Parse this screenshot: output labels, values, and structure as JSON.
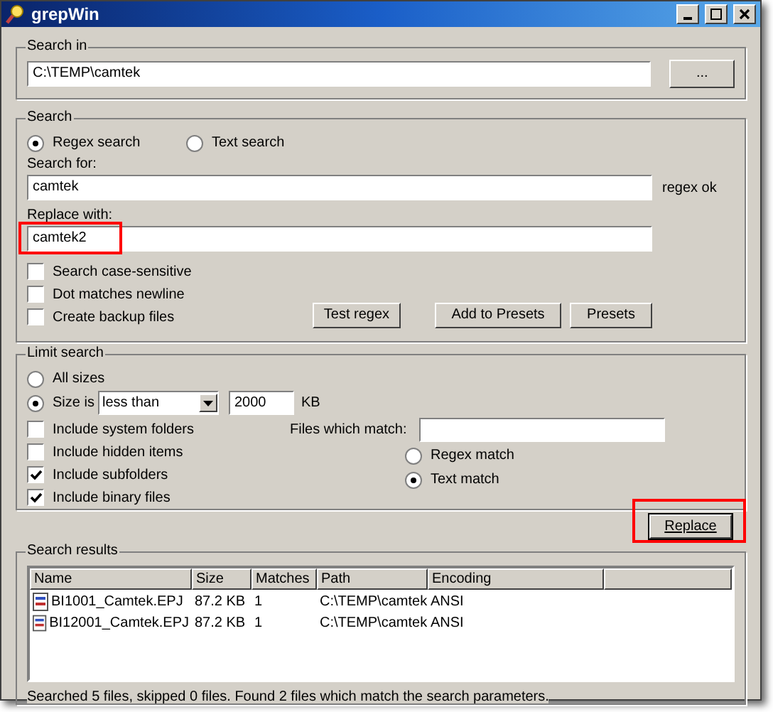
{
  "window": {
    "title": "grepWin"
  },
  "search_in": {
    "label": "Search in",
    "path": "C:\\TEMP\\camtek",
    "browse_button": "..."
  },
  "search": {
    "label": "Search",
    "modes": [
      {
        "label": "Regex search",
        "selected": true
      },
      {
        "label": "Text search",
        "selected": false
      }
    ],
    "search_for_label": "Search for:",
    "search_for": "camtek",
    "regex_status": "regex ok",
    "replace_label": "Replace with:",
    "replace_with": "camtek2",
    "replace_with_highlighted": true,
    "options": [
      {
        "label": "Search case-sensitive",
        "checked": false
      },
      {
        "label": "Dot matches newline",
        "checked": false
      },
      {
        "label": "Create backup files",
        "checked": false
      }
    ],
    "buttons": [
      "Test regex",
      "Add to Presets",
      "Presets"
    ]
  },
  "limit": {
    "label": "Limit search",
    "sizes": [
      {
        "label": "All sizes",
        "selected": false
      },
      {
        "label": "Size is",
        "selected": true
      }
    ],
    "size_condition": "less than",
    "size_value": "2000",
    "size_unit": "KB",
    "options": [
      {
        "label": "Include system folders",
        "checked": false
      },
      {
        "label": "Include hidden items",
        "checked": false
      },
      {
        "label": "Include subfolders",
        "checked": true
      },
      {
        "label": "Include binary files",
        "checked": true
      }
    ],
    "files_match_label": "Files which match:",
    "match_modes": [
      {
        "label": "Regex match",
        "selected": false
      },
      {
        "label": "Text match",
        "selected": true
      }
    ]
  },
  "replace_button": {
    "label": "Replace",
    "highlighted": true
  },
  "results": {
    "label": "Search results",
    "columns": [
      "Name",
      "Size",
      "Matches",
      "Path",
      "Encoding"
    ],
    "rows": [
      {
        "name": "BI1001_Camtek.EPJ",
        "size": "87.2 KB",
        "matches": "1",
        "path": "C:\\TEMP\\camtek",
        "encoding": "ANSI"
      },
      {
        "name": "BI12001_Camtek.EPJ",
        "size": "87.2 KB",
        "matches": "1",
        "path": "C:\\TEMP\\camtek",
        "encoding": "ANSI"
      }
    ]
  },
  "status_bar": "Searched 5 files, skipped 0 files. Found 2 files which match the search parameters."
}
